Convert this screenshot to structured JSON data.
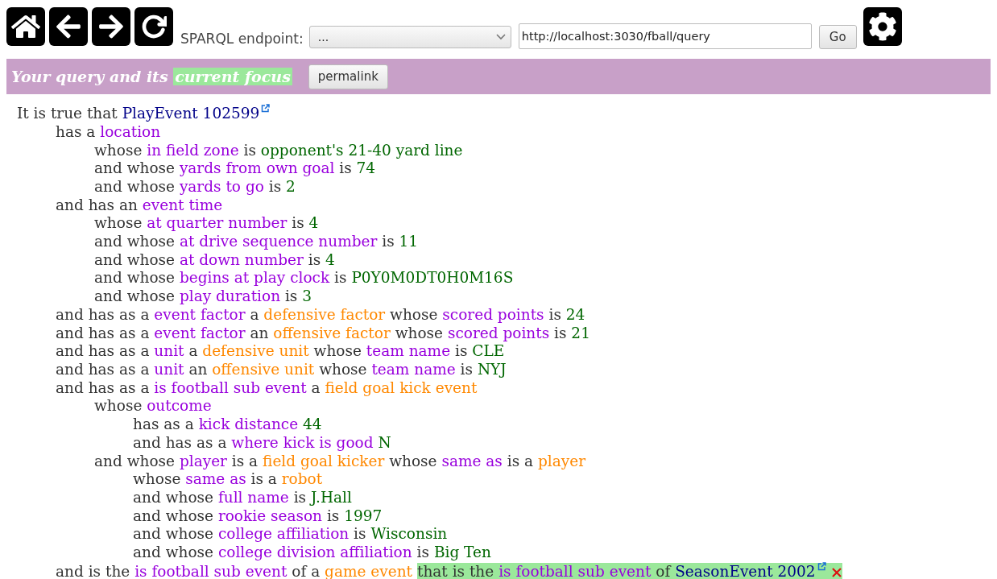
{
  "toolbar": {
    "endpoint_label": "SPARQL endpoint:",
    "endpoint_select": "...",
    "endpoint_url": "http://localhost:3030/fball/query",
    "go_button": "Go"
  },
  "query_bar": {
    "title": "Your query and its",
    "focus_title": "current focus",
    "permalink_button": "permalink"
  },
  "query": {
    "segments": [
      {
        "kind": "text",
        "text": "It is true that"
      },
      {
        "kind": "entity",
        "text": "PlayEvent 102599"
      },
      {
        "kind": "link"
      }
    ],
    "children": [
      {
        "segments": [
          {
            "kind": "text",
            "text": "has a"
          },
          {
            "kind": "property",
            "text": "location"
          }
        ],
        "children": [
          {
            "segments": [
              {
                "kind": "text",
                "text": "whose"
              },
              {
                "kind": "property",
                "text": "in field zone"
              },
              {
                "kind": "text",
                "text": "is"
              },
              {
                "kind": "value",
                "text": "opponent's 21-40 yard line"
              }
            ]
          },
          {
            "segments": [
              {
                "kind": "text",
                "text": "and whose"
              },
              {
                "kind": "property",
                "text": "yards from own goal"
              },
              {
                "kind": "text",
                "text": "is"
              },
              {
                "kind": "value",
                "text": "74"
              }
            ]
          },
          {
            "segments": [
              {
                "kind": "text",
                "text": "and whose"
              },
              {
                "kind": "property",
                "text": "yards to go"
              },
              {
                "kind": "text",
                "text": "is"
              },
              {
                "kind": "value",
                "text": "2"
              }
            ]
          }
        ]
      },
      {
        "segments": [
          {
            "kind": "text",
            "text": "and has an"
          },
          {
            "kind": "property",
            "text": "event time"
          }
        ],
        "children": [
          {
            "segments": [
              {
                "kind": "text",
                "text": "whose"
              },
              {
                "kind": "property",
                "text": "at quarter number"
              },
              {
                "kind": "text",
                "text": "is"
              },
              {
                "kind": "value",
                "text": "4"
              }
            ]
          },
          {
            "segments": [
              {
                "kind": "text",
                "text": "and whose"
              },
              {
                "kind": "property",
                "text": "at drive sequence number"
              },
              {
                "kind": "text",
                "text": "is"
              },
              {
                "kind": "value",
                "text": "11"
              }
            ]
          },
          {
            "segments": [
              {
                "kind": "text",
                "text": "and whose"
              },
              {
                "kind": "property",
                "text": "at down number"
              },
              {
                "kind": "text",
                "text": "is"
              },
              {
                "kind": "value",
                "text": "4"
              }
            ]
          },
          {
            "segments": [
              {
                "kind": "text",
                "text": "and whose"
              },
              {
                "kind": "property",
                "text": "begins at play clock"
              },
              {
                "kind": "text",
                "text": "is"
              },
              {
                "kind": "value",
                "text": "P0Y0M0DT0H0M16S"
              }
            ]
          },
          {
            "segments": [
              {
                "kind": "text",
                "text": "and whose"
              },
              {
                "kind": "property",
                "text": "play duration"
              },
              {
                "kind": "text",
                "text": "is"
              },
              {
                "kind": "value",
                "text": "3"
              }
            ]
          }
        ]
      },
      {
        "segments": [
          {
            "kind": "text",
            "text": "and has as a"
          },
          {
            "kind": "property",
            "text": "event factor"
          },
          {
            "kind": "text",
            "text": "a"
          },
          {
            "kind": "class",
            "text": "defensive factor"
          },
          {
            "kind": "text",
            "text": "whose"
          },
          {
            "kind": "property",
            "text": "scored points"
          },
          {
            "kind": "text",
            "text": "is"
          },
          {
            "kind": "value",
            "text": "24"
          }
        ]
      },
      {
        "segments": [
          {
            "kind": "text",
            "text": "and has as a"
          },
          {
            "kind": "property",
            "text": "event factor"
          },
          {
            "kind": "text",
            "text": "an"
          },
          {
            "kind": "class",
            "text": "offensive factor"
          },
          {
            "kind": "text",
            "text": "whose"
          },
          {
            "kind": "property",
            "text": "scored points"
          },
          {
            "kind": "text",
            "text": "is"
          },
          {
            "kind": "value",
            "text": "21"
          }
        ]
      },
      {
        "segments": [
          {
            "kind": "text",
            "text": "and has as a"
          },
          {
            "kind": "property",
            "text": "unit"
          },
          {
            "kind": "text",
            "text": "a"
          },
          {
            "kind": "class",
            "text": "defensive unit"
          },
          {
            "kind": "text",
            "text": "whose"
          },
          {
            "kind": "property",
            "text": "team name"
          },
          {
            "kind": "text",
            "text": "is"
          },
          {
            "kind": "value",
            "text": "CLE"
          }
        ]
      },
      {
        "segments": [
          {
            "kind": "text",
            "text": "and has as a"
          },
          {
            "kind": "property",
            "text": "unit"
          },
          {
            "kind": "text",
            "text": "an"
          },
          {
            "kind": "class",
            "text": "offensive unit"
          },
          {
            "kind": "text",
            "text": "whose"
          },
          {
            "kind": "property",
            "text": "team name"
          },
          {
            "kind": "text",
            "text": "is"
          },
          {
            "kind": "value",
            "text": "NYJ"
          }
        ]
      },
      {
        "segments": [
          {
            "kind": "text",
            "text": "and has as a"
          },
          {
            "kind": "property",
            "text": "is football sub event"
          },
          {
            "kind": "text",
            "text": "a"
          },
          {
            "kind": "class",
            "text": "field goal kick event"
          }
        ],
        "children": [
          {
            "segments": [
              {
                "kind": "text",
                "text": "whose"
              },
              {
                "kind": "property",
                "text": "outcome"
              }
            ],
            "children": [
              {
                "segments": [
                  {
                    "kind": "text",
                    "text": "has as a"
                  },
                  {
                    "kind": "property",
                    "text": "kick distance"
                  },
                  {
                    "kind": "value",
                    "text": "44"
                  }
                ]
              },
              {
                "segments": [
                  {
                    "kind": "text",
                    "text": "and has as a"
                  },
                  {
                    "kind": "property",
                    "text": "where kick is good"
                  },
                  {
                    "kind": "value",
                    "text": "N"
                  }
                ]
              }
            ]
          },
          {
            "segments": [
              {
                "kind": "text",
                "text": "and whose"
              },
              {
                "kind": "property",
                "text": "player"
              },
              {
                "kind": "text",
                "text": "is a"
              },
              {
                "kind": "class",
                "text": "field goal kicker"
              },
              {
                "kind": "text",
                "text": "whose"
              },
              {
                "kind": "property",
                "text": "same as"
              },
              {
                "kind": "text",
                "text": "is a"
              },
              {
                "kind": "class",
                "text": "player"
              }
            ],
            "children": [
              {
                "segments": [
                  {
                    "kind": "text",
                    "text": "whose"
                  },
                  {
                    "kind": "property",
                    "text": "same as"
                  },
                  {
                    "kind": "text",
                    "text": "is a"
                  },
                  {
                    "kind": "class",
                    "text": "robot"
                  }
                ]
              },
              {
                "segments": [
                  {
                    "kind": "text",
                    "text": "and whose"
                  },
                  {
                    "kind": "property",
                    "text": "full name"
                  },
                  {
                    "kind": "text",
                    "text": "is"
                  },
                  {
                    "kind": "value",
                    "text": "J.Hall"
                  }
                ]
              },
              {
                "segments": [
                  {
                    "kind": "text",
                    "text": "and whose"
                  },
                  {
                    "kind": "property",
                    "text": "rookie season"
                  },
                  {
                    "kind": "text",
                    "text": "is"
                  },
                  {
                    "kind": "value",
                    "text": "1997"
                  }
                ]
              },
              {
                "segments": [
                  {
                    "kind": "text",
                    "text": "and whose"
                  },
                  {
                    "kind": "property",
                    "text": "college affiliation"
                  },
                  {
                    "kind": "text",
                    "text": "is"
                  },
                  {
                    "kind": "value",
                    "text": "Wisconsin"
                  }
                ]
              },
              {
                "segments": [
                  {
                    "kind": "text",
                    "text": "and whose"
                  },
                  {
                    "kind": "property",
                    "text": "college division affiliation"
                  },
                  {
                    "kind": "text",
                    "text": "is"
                  },
                  {
                    "kind": "value",
                    "text": "Big Ten"
                  }
                ]
              }
            ]
          }
        ]
      },
      {
        "segments": [
          {
            "kind": "text",
            "text": "and is the"
          },
          {
            "kind": "property",
            "text": "is football sub event"
          },
          {
            "kind": "text",
            "text": "of a"
          },
          {
            "kind": "class",
            "text": "game event"
          }
        ],
        "focus": [
          {
            "kind": "text",
            "text": "that is the"
          },
          {
            "kind": "property",
            "text": "is football sub event"
          },
          {
            "kind": "text",
            "text": "of"
          },
          {
            "kind": "entity",
            "text": "SeasonEvent 2002"
          },
          {
            "kind": "link"
          },
          {
            "kind": "delete"
          }
        ]
      }
    ]
  }
}
